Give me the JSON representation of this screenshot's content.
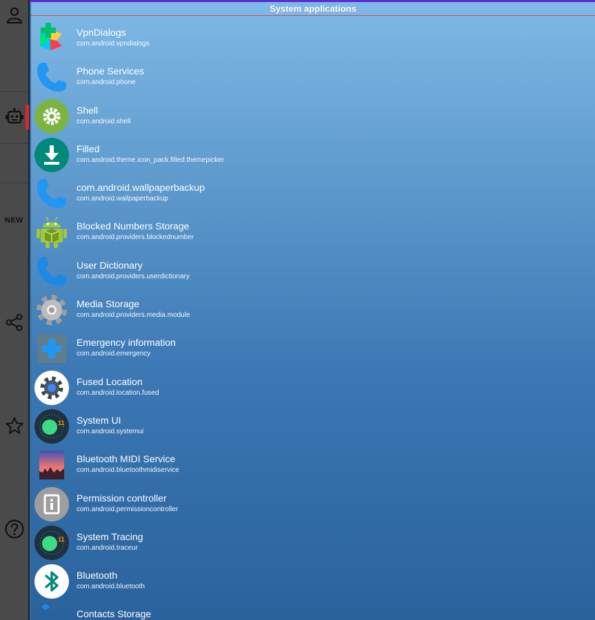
{
  "header": {
    "title": "System applications"
  },
  "sidebar": {
    "items": [
      {
        "icon": "person-icon"
      },
      {
        "icon": "robot-icon"
      },
      {
        "label": "NEW"
      },
      {
        "icon": "share-icon"
      },
      {
        "icon": "star-icon"
      },
      {
        "icon": "help-icon"
      }
    ],
    "active_color": "#e0262a"
  },
  "apps": [
    {
      "name": "VpnDialogs",
      "package": "com.android.vpndialogs",
      "icon": "play-store-icon"
    },
    {
      "name": "Phone Services",
      "package": "com.android.phone",
      "icon": "phone-icon"
    },
    {
      "name": "Shell",
      "package": "com.android.shell",
      "icon": "gear-green-icon"
    },
    {
      "name": "Filled",
      "package": "com.android.theme.icon_pack.filled.themepicker",
      "icon": "download-icon"
    },
    {
      "name": "com.android.wallpaperbackup",
      "package": "com.android.wallpaperbackup",
      "icon": "phone-icon"
    },
    {
      "name": "Blocked Numbers Storage",
      "package": "com.android.providers.blockednumber",
      "icon": "android-robot-icon"
    },
    {
      "name": "User Dictionary",
      "package": "com.android.providers.userdictionary",
      "icon": "phone-icon"
    },
    {
      "name": "Media Storage",
      "package": "com.android.providers.media.module",
      "icon": "gear-grey-icon"
    },
    {
      "name": "Emergency information",
      "package": "com.android.emergency",
      "icon": "medical-cross-icon"
    },
    {
      "name": "Fused Location",
      "package": "com.android.location.fused",
      "icon": "settings-dark-icon"
    },
    {
      "name": "System UI",
      "package": "com.android.systemui",
      "icon": "android11-icon"
    },
    {
      "name": "Bluetooth MIDI Service",
      "package": "com.android.bluetoothmidiservice",
      "icon": "landscape-icon"
    },
    {
      "name": "Permission controller",
      "package": "com.android.permissioncontroller",
      "icon": "info-grey-icon"
    },
    {
      "name": "System Tracing",
      "package": "com.android.traceur",
      "icon": "android11-icon"
    },
    {
      "name": "Bluetooth",
      "package": "com.android.bluetooth",
      "icon": "bluetooth-icon"
    },
    {
      "name": "Contacts Storage",
      "package": "",
      "icon": "contacts-icon"
    }
  ]
}
